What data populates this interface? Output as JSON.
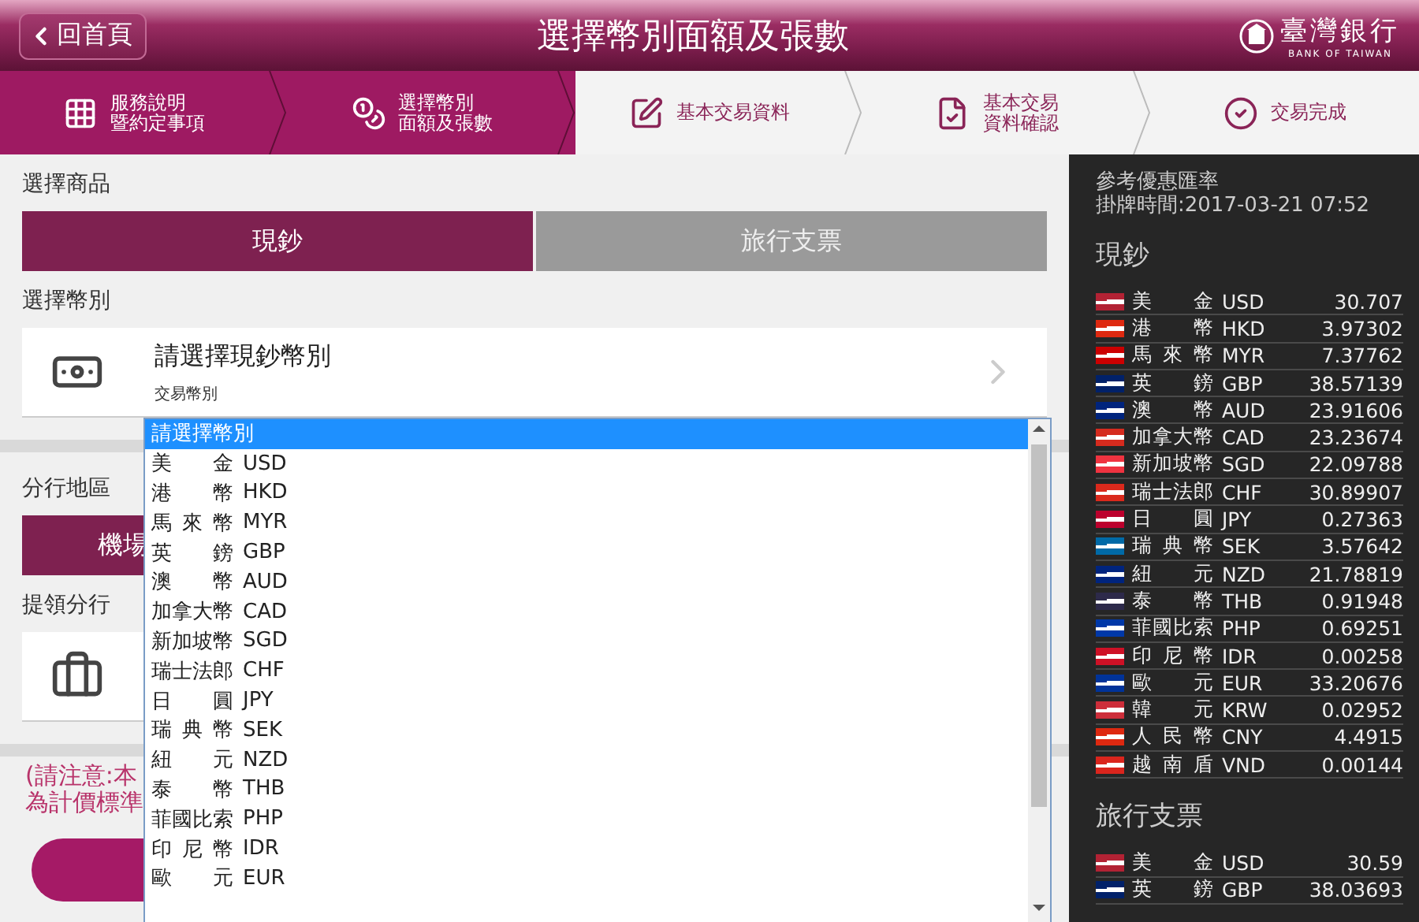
{
  "header": {
    "back_label": "回首頁",
    "title": "選擇幣別面額及張數",
    "logo_name": "臺灣銀行",
    "logo_subtitle": "BANK OF TAIWAN"
  },
  "steps": [
    {
      "lines": [
        "服務說明",
        "暨約定事項"
      ],
      "active": true,
      "kind": "grid"
    },
    {
      "lines": [
        "選擇幣別",
        "面額及張數"
      ],
      "active": true,
      "kind": "coins"
    },
    {
      "lines": [
        "基本交易資料"
      ],
      "active": false,
      "kind": "form"
    },
    {
      "lines": [
        "基本交易",
        "資料確認"
      ],
      "active": false,
      "kind": "document"
    },
    {
      "lines": [
        "交易完成"
      ],
      "active": false,
      "kind": "check"
    }
  ],
  "product": {
    "label": "選擇商品",
    "tabs": [
      {
        "label": "現鈔",
        "selected": true
      },
      {
        "label": "旅行支票",
        "selected": false
      }
    ]
  },
  "currency": {
    "label": "選擇幣別",
    "title": "請選擇現鈔幣別",
    "subtitle": "交易幣別"
  },
  "branch_area": {
    "label": "分行地區",
    "options": [
      {
        "label": "機場",
        "selected": true
      }
    ]
  },
  "pickup_branch": {
    "label": "提領分行"
  },
  "notice": [
    "(請注意:本",
    "為計價標準"
  ],
  "dropdown": [
    {
      "name": "請選擇幣別",
      "selected": true
    },
    {
      "name": "美金",
      "code": "USD",
      "selected": false
    },
    {
      "name": "港幣",
      "code": "HKD",
      "selected": false
    },
    {
      "name": "馬來幣",
      "code": "MYR",
      "selected": false
    },
    {
      "name": "英鎊",
      "code": "GBP",
      "selected": false
    },
    {
      "name": "澳幣",
      "code": "AUD",
      "selected": false
    },
    {
      "name": "加拿大幣",
      "code": "CAD",
      "selected": false
    },
    {
      "name": "新加坡幣",
      "code": "SGD",
      "selected": false
    },
    {
      "name": "瑞士法郎",
      "code": "CHF",
      "selected": false
    },
    {
      "name": "日圓",
      "code": "JPY",
      "selected": false
    },
    {
      "name": "瑞典幣",
      "code": "SEK",
      "selected": false
    },
    {
      "name": "紐元",
      "code": "NZD",
      "selected": false
    },
    {
      "name": "泰幣",
      "code": "THB",
      "selected": false
    },
    {
      "name": "菲國比索",
      "code": "PHP",
      "selected": false
    },
    {
      "name": "印尼幣",
      "code": "IDR",
      "selected": false
    },
    {
      "name": "歐元",
      "code": "EUR",
      "selected": false
    }
  ],
  "rates": {
    "title": "參考優惠匯率",
    "time": "掛牌時間:2017-03-21 07:52",
    "sections": [
      {
        "title": "現鈔",
        "rows": [
          {
            "name": "美金",
            "code": "USD",
            "rate": "30.707",
            "color": "#b22234"
          },
          {
            "name": "港幣",
            "code": "HKD",
            "rate": "3.97302",
            "color": "#de2910"
          },
          {
            "name": "馬來幣",
            "code": "MYR",
            "rate": "7.37762",
            "color": "#cc0001"
          },
          {
            "name": "英鎊",
            "code": "GBP",
            "rate": "38.57139",
            "color": "#012169"
          },
          {
            "name": "澳幣",
            "code": "AUD",
            "rate": "23.91606",
            "color": "#00247d"
          },
          {
            "name": "加拿大幣",
            "code": "CAD",
            "rate": "23.23674",
            "color": "#d52b1e"
          },
          {
            "name": "新加坡幣",
            "code": "SGD",
            "rate": "22.09788",
            "color": "#ef3340"
          },
          {
            "name": "瑞士法郎",
            "code": "CHF",
            "rate": "30.89907",
            "color": "#da291c"
          },
          {
            "name": "日圓",
            "code": "JPY",
            "rate": "0.27363",
            "color": "#bc002d"
          },
          {
            "name": "瑞典幣",
            "code": "SEK",
            "rate": "3.57642",
            "color": "#006aa7"
          },
          {
            "name": "紐元",
            "code": "NZD",
            "rate": "21.78819",
            "color": "#00247e"
          },
          {
            "name": "泰幣",
            "code": "THB",
            "rate": "0.91948",
            "color": "#2d2a4a"
          },
          {
            "name": "菲國比索",
            "code": "PHP",
            "rate": "0.69251",
            "color": "#0038a8"
          },
          {
            "name": "印尼幣",
            "code": "IDR",
            "rate": "0.00258",
            "color": "#ce1126"
          },
          {
            "name": "歐元",
            "code": "EUR",
            "rate": "33.20676",
            "color": "#003399"
          },
          {
            "name": "韓元",
            "code": "KRW",
            "rate": "0.02952",
            "color": "#cd2e3a"
          },
          {
            "name": "人民幣",
            "code": "CNY",
            "rate": "4.4915",
            "color": "#de2910"
          },
          {
            "name": "越南盾",
            "code": "VND",
            "rate": "0.00144",
            "color": "#da251d"
          }
        ]
      },
      {
        "title": "旅行支票",
        "rows": [
          {
            "name": "美金",
            "code": "USD",
            "rate": "30.59",
            "color": "#b22234"
          },
          {
            "name": "英鎊",
            "code": "GBP",
            "rate": "38.03693",
            "color": "#012169"
          }
        ]
      }
    ]
  }
}
